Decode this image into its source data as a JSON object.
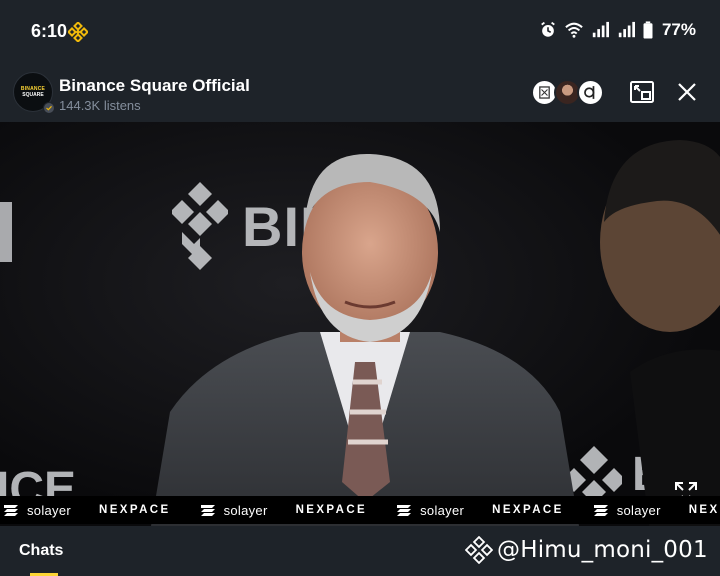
{
  "status_bar": {
    "time": "6:10",
    "battery": "77%",
    "icons": [
      "binance-logo-icon",
      "alarm-icon",
      "wifi-icon",
      "signal-icon",
      "signal-icon",
      "battery-icon"
    ]
  },
  "header": {
    "channel_name": "Binance Square Official",
    "listens": "144.3K listens",
    "avatar_line1": "BINANCE",
    "avatar_line2": "SQUARE",
    "icons": [
      "verified-icon",
      "picture-in-picture-icon",
      "close-icon"
    ]
  },
  "video": {
    "watermark_brand": "BINA",
    "watermark_brand_2": "BI",
    "watermark_brand_3": "ICE",
    "icons": [
      "fullscreen-icon"
    ]
  },
  "ticker": {
    "items": [
      "solayer",
      "NEXPACE",
      "solayer",
      "NEXPACE",
      "solayer",
      "NEXPACE",
      "solayer",
      "NEXPACE"
    ]
  },
  "bottom_bar": {
    "chats_label": "Chats",
    "watermark": "@Himu_moni_001"
  },
  "colors": {
    "background": "#1e2329",
    "accent": "#fcd535",
    "text_primary": "#ffffff",
    "text_secondary": "#848e9c"
  }
}
